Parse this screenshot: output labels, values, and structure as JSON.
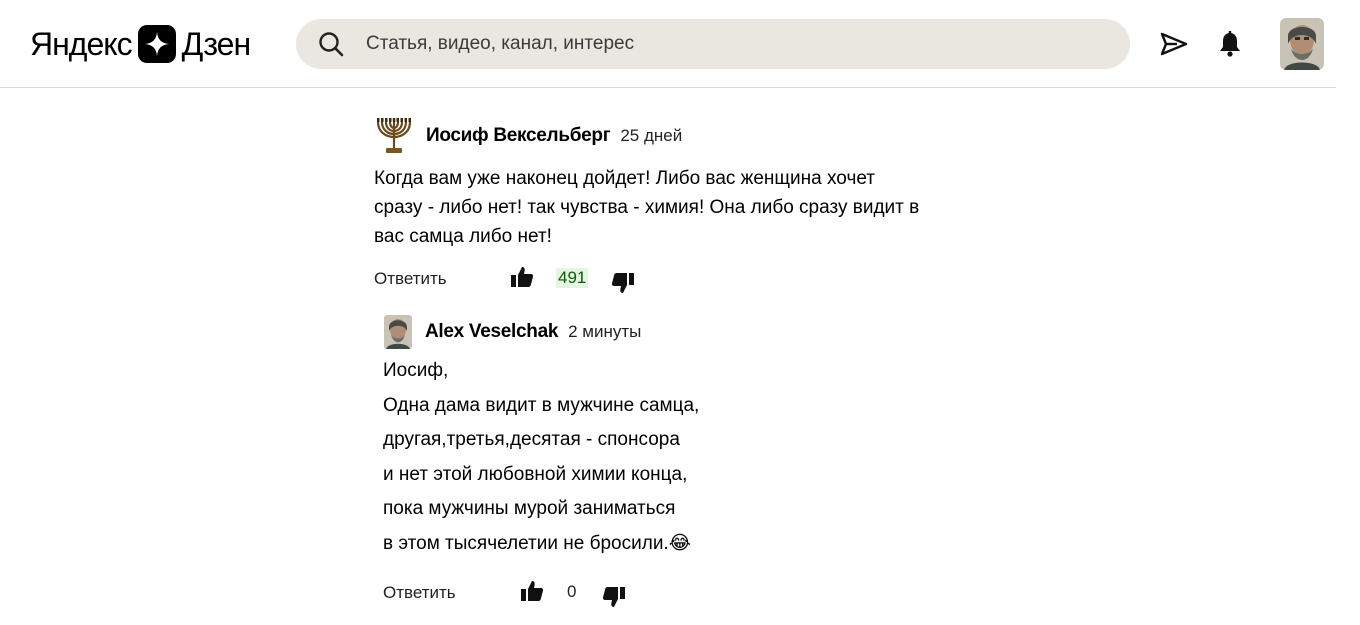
{
  "header": {
    "logo_left": "Яндекс",
    "logo_right": "Дзен",
    "search_placeholder": "Статья, видео, канал, интерес"
  },
  "comments": [
    {
      "author": "Иосиф Вексельберг",
      "time": "25 дней",
      "lines": [
        "Когда вам уже наконец дойдет! Либо вас женщина хочет",
        "сразу - либо нет! так чувства - химия! Она либо сразу видит в",
        "вас самца либо нет!"
      ],
      "reply_label": "Ответить",
      "likes": "491",
      "avatar_icon": "menorah-icon"
    },
    {
      "author": "Alex Veselchak",
      "time": "2 минуты",
      "lines": [
        "Иосиф,",
        "Одна дама видит в мужчине самца,",
        "другая,третья,десятая - спонсора",
        "и нет этой любовной химии конца,",
        "пока мужчины мурой заниматься",
        "в этом тысячелетии не бросили.😂"
      ],
      "reply_label": "Ответить",
      "likes": "0",
      "avatar_icon": "user-avatar"
    }
  ],
  "colors": {
    "search_bg": "#e9e7e0",
    "likes_highlight": "#0a5c0a"
  }
}
